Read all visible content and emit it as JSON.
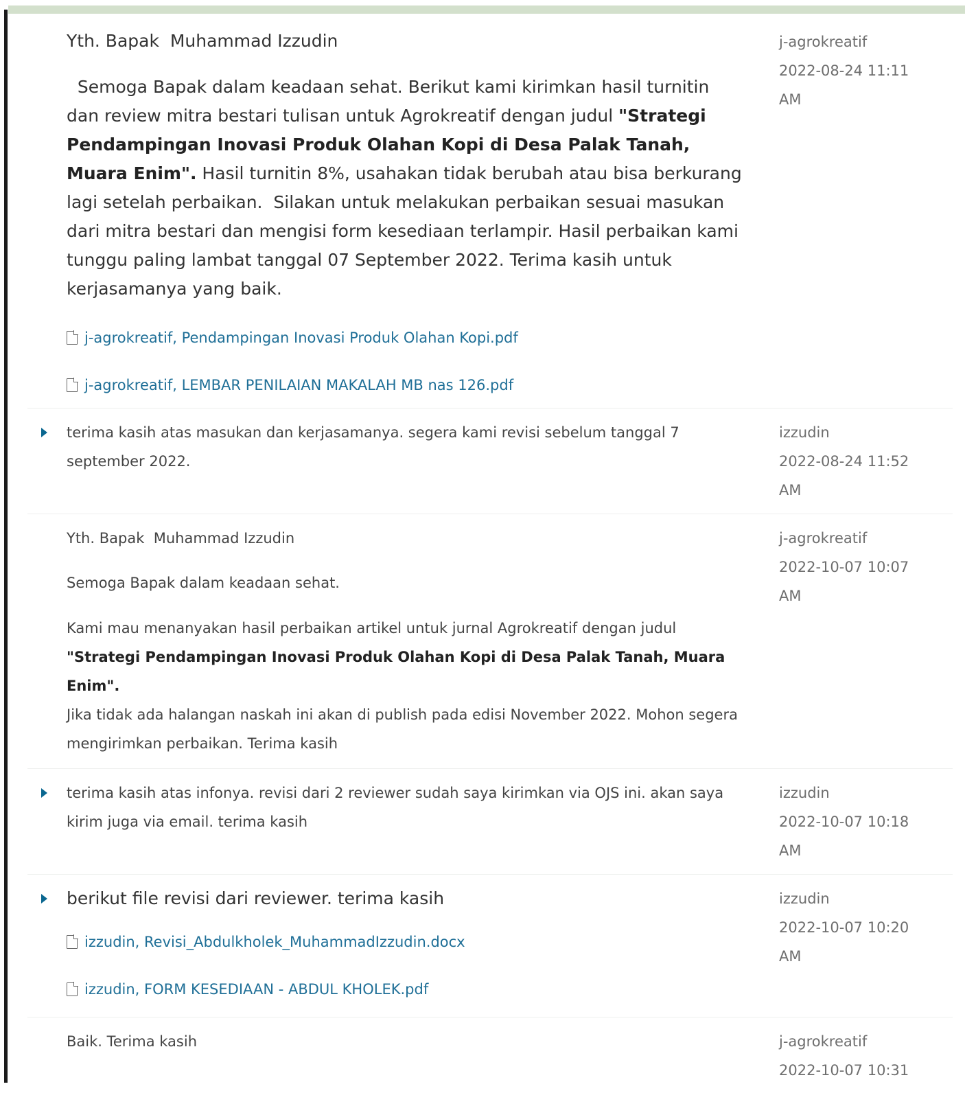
{
  "messages": [
    {
      "greeting": "Yth. Bapak  Muhammad Izzudin",
      "body_pre": "  Semoga Bapak dalam keadaan sehat. Berikut kami kirimkan hasil turnitin dan review mitra bestari tulisan untuk Agrokreatif dengan judul ",
      "body_bold": "\"Strategi Pendampingan Inovasi Produk Olahan Kopi di Desa Palak Tanah, Muara Enim\".",
      "body_post": " Hasil turnitin 8%, usahakan tidak berubah atau bisa berkurang lagi setelah perbaikan.  Silakan untuk melakukan perbaikan sesuai masukan dari mitra bestari dan mengisi form kesediaan terlampir. Hasil perbaikan kami tunggu paling lambat tanggal 07 September 2022. Terima kasih untuk kerjasamanya yang baik.",
      "files": [
        "j-agrokreatif, Pendampingan Inovasi Produk Olahan Kopi.pdf",
        "j-agrokreatif, LEMBAR PENILAIAN MAKALAH MB nas 126.pdf"
      ],
      "author": "j-agrokreatif",
      "date": "2022-08-24 11:11",
      "ampm": "AM"
    },
    {
      "body": "terima kasih atas masukan dan kerjasamanya. segera kami revisi sebelum tanggal 7 september 2022.",
      "author": "izzudin",
      "date": "2022-08-24 11:52",
      "ampm": "AM"
    },
    {
      "greeting": "Yth. Bapak  Muhammad Izzudin",
      "line1": "Semoga Bapak dalam keadaan sehat.",
      "body_pre": "Kami mau menanyakan hasil perbaikan artikel untuk jurnal Agrokreatif dengan judul ",
      "body_bold": "\"Strategi Pendampingan Inovasi Produk Olahan Kopi di Desa Palak Tanah, Muara Enim\".",
      "body_post": "Jika tidak ada halangan naskah ini akan di publish pada edisi November 2022. Mohon segera mengirimkan perbaikan. Terima kasih",
      "author": "j-agrokreatif",
      "date": "2022-10-07 10:07",
      "ampm": "AM"
    },
    {
      "body": "terima kasih atas infonya. revisi dari 2 reviewer sudah saya kirimkan via OJS ini. akan saya kirim juga via email. terima kasih",
      "author": "izzudin",
      "date": "2022-10-07 10:18",
      "ampm": "AM"
    },
    {
      "body": "berikut file revisi dari reviewer. terima kasih",
      "files": [
        "izzudin, Revisi_Abdulkholek_MuhammadIzzudin.docx",
        "izzudin, FORM KESEDIAAN - ABDUL KHOLEK.pdf"
      ],
      "author": "izzudin",
      "date": "2022-10-07 10:20",
      "ampm": "AM"
    },
    {
      "body": "Baik. Terima kasih",
      "author": "j-agrokreatif",
      "date": "2022-10-07 10:31"
    }
  ]
}
